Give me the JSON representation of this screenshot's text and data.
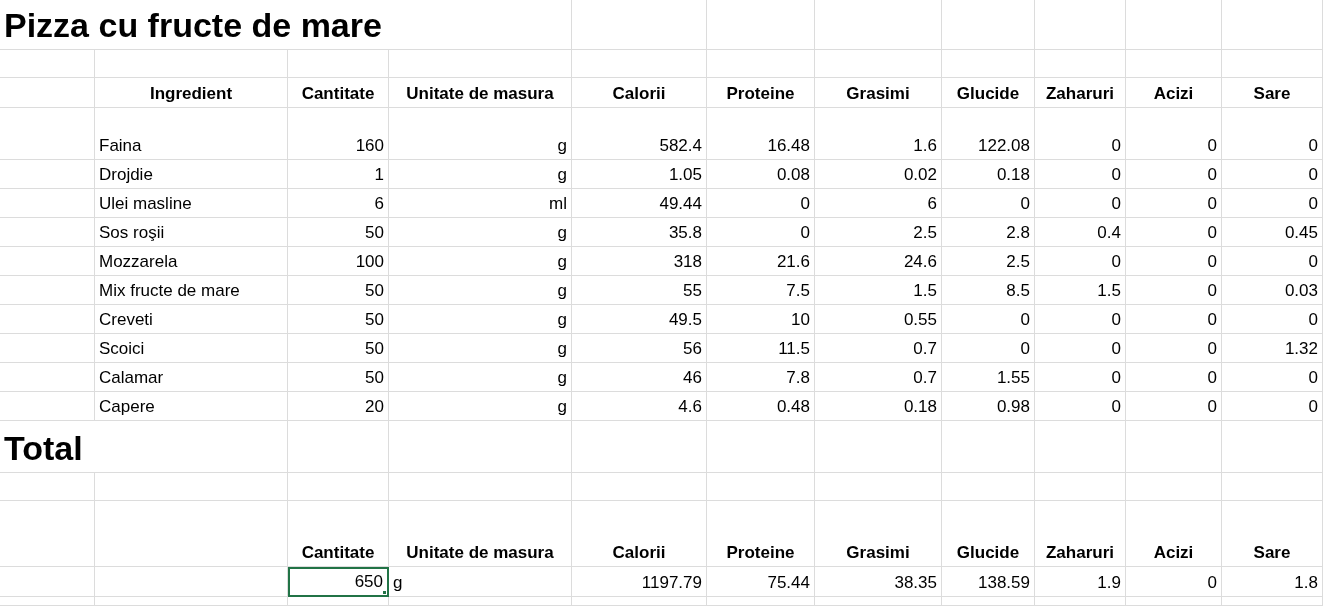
{
  "title": "Pizza cu fructe de mare",
  "ingredients_table": {
    "columns": [
      "Ingredient",
      "Cantitate",
      "Unitate de masura",
      "Calorii",
      "Proteine",
      "Grasimi",
      "Glucide",
      "Zaharuri",
      "Acizi",
      "Sare"
    ],
    "rows": [
      [
        "Faina",
        "160",
        "g",
        "582.4",
        "16.48",
        "1.6",
        "122.08",
        "0",
        "0",
        "0"
      ],
      [
        "Drojdie",
        "1",
        "g",
        "1.05",
        "0.08",
        "0.02",
        "0.18",
        "0",
        "0",
        "0"
      ],
      [
        "Ulei masline",
        "6",
        "ml",
        "49.44",
        "0",
        "6",
        "0",
        "0",
        "0",
        "0"
      ],
      [
        "Sos roşii",
        "50",
        "g",
        "35.8",
        "0",
        "2.5",
        "2.8",
        "0.4",
        "0",
        "0.45"
      ],
      [
        "Mozzarela",
        "100",
        "g",
        "318",
        "21.6",
        "24.6",
        "2.5",
        "0",
        "0",
        "0"
      ],
      [
        "Mix fructe de mare",
        "50",
        "g",
        "55",
        "7.5",
        "1.5",
        "8.5",
        "1.5",
        "0",
        "0.03"
      ],
      [
        "Creveti",
        "50",
        "g",
        "49.5",
        "10",
        "0.55",
        "0",
        "0",
        "0",
        "0"
      ],
      [
        "Scoici",
        "50",
        "g",
        "56",
        "11.5",
        "0.7",
        "0",
        "0",
        "0",
        "1.32"
      ],
      [
        "Calamar",
        "50",
        "g",
        "46",
        "7.8",
        "0.7",
        "1.55",
        "0",
        "0",
        "0"
      ],
      [
        "Capere",
        "20",
        "g",
        "4.6",
        "0.48",
        "0.18",
        "0.98",
        "0",
        "0",
        "0"
      ]
    ]
  },
  "total": {
    "title": "Total",
    "columns": [
      "Cantitate",
      "Unitate de masura",
      "Calorii",
      "Proteine",
      "Grasimi",
      "Glucide",
      "Zaharuri",
      "Acizi",
      "Sare"
    ],
    "values": [
      {
        "text": "650",
        "selected": true
      },
      {
        "text": "g",
        "selected": false
      },
      {
        "text": "1197.79",
        "selected": false
      },
      {
        "text": "75.44",
        "selected": false
      },
      {
        "text": "38.35",
        "selected": false
      },
      {
        "text": "138.59",
        "selected": false
      },
      {
        "text": "1.9",
        "selected": false
      },
      {
        "text": "0",
        "selected": false
      },
      {
        "text": "1.8",
        "selected": false
      }
    ]
  }
}
